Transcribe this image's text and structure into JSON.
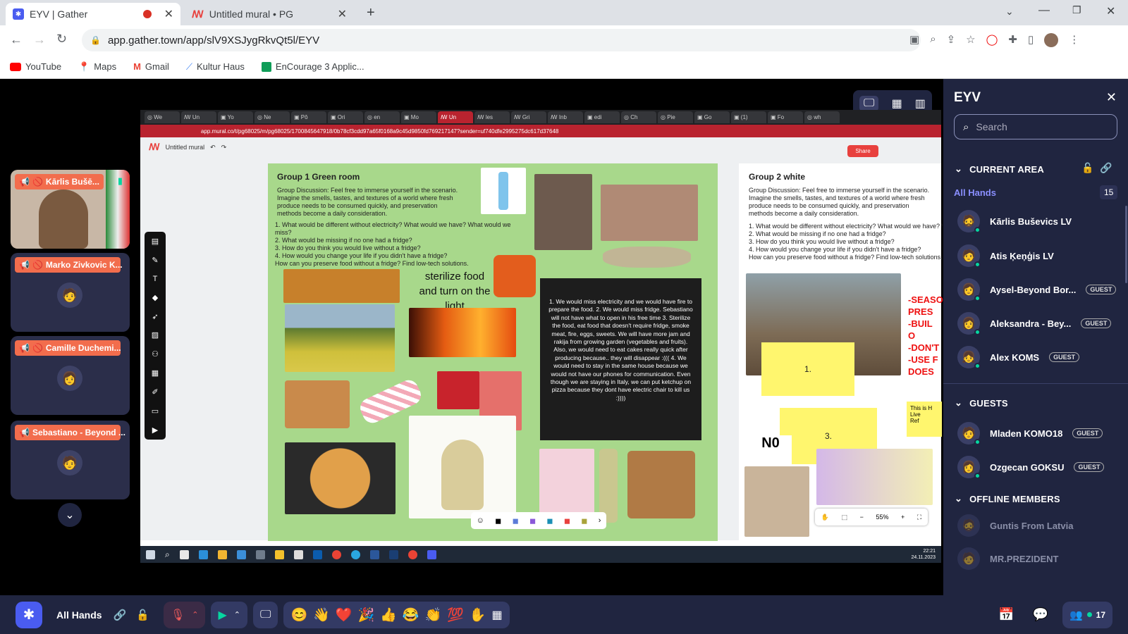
{
  "browser": {
    "tabs": [
      {
        "title": "EYV | Gather",
        "active": true
      },
      {
        "title": "Untitled mural • PG",
        "active": false
      }
    ],
    "url": "app.gather.town/app/slV9XSJygRkvQt5l/EYV",
    "bookmarks": [
      "YouTube",
      "Maps",
      "Gmail",
      "Kultur Haus",
      "EnCourage 3 Applic..."
    ]
  },
  "video_tiles": [
    {
      "name": "Kārlis Bušē..."
    },
    {
      "name": "Marko Zivkovic K..."
    },
    {
      "name": "Camille Duchemi..."
    },
    {
      "name": "Sebastiano - Beyond ..."
    }
  ],
  "shared_screen": {
    "url": "app.mural.co/t/pg68025/m/pg68025/1700845647918/0b78cf3cdd97a65f0168a9c45d9850fd769217147?sender=uf740dfe2995275dc617d37648",
    "mural_title": "Untitled mural",
    "share_label": "Share",
    "zoom": "55%",
    "group1": {
      "title": "Group 1 Green room",
      "intro": "Group Discussion: Feel free to immerse yourself in the scenario. Imagine the smells, tastes, and textures of a world where fresh produce needs to be consumed quickly, and preservation methods become a daily consideration.",
      "questions": [
        "1. What would be different without electricity? What would we have? What would we miss?",
        "2. What would be missing if no one had a fridge?",
        "3. How do you think you would live without a fridge?",
        "4. How would you change your life if you didn't have a fridge?",
        "How can you preserve food without a fridge? Find low-tech solutions."
      ],
      "note": "sterilize food and turn on the light",
      "answer": "1. We would miss electricity and we would have fire to prepare the food. 2. We would miss fridge. Sebastiano will not have what to open in his free time 3. Sterilize the food, eat food that doesn't require fridge, smoke meat, fire, eggs, sweets. We will have more jam and rakija from growing garden (vegetables and fruits). Also, we would need to eat cakes really quick after producing because.. they will disappear :((( 4. We would need to stay in the same house because we would not have our phones for communication. Even though we are staying in Italy, we can put ketchup on pizza because they dont have electric chair to kill us :))))"
    },
    "group2": {
      "title": "Group 2 white",
      "intro": "Group Discussion: Feel free to immerse yourself in the scenario. Imagine the smells, tastes, and textures of a world where fresh produce needs to be consumed quickly, and preservation methods become a daily consideration.",
      "questions": [
        "1. What would be different without electricity? What would we have? What would we miss?",
        "2. What would be missing if no one had a fridge?",
        "3. How do you think you would live without a fridge?",
        "4. How would you change your life if you didn't have a fridge?",
        "How can you preserve food without a fridge? Find low-tech solutions."
      ],
      "stickies": [
        "1.",
        "3."
      ],
      "no_label": "N0",
      "red_notes": "-SEASO\nPRES\n-BUIL\nO\n-DON'T\n-USE F\nDOES",
      "yellow_note": "This is H\nLive\nRef"
    },
    "taskbar_time": "22:21",
    "taskbar_date": "24.11.2023"
  },
  "sidebar": {
    "title": "EYV",
    "search_placeholder": "Search",
    "current_area_label": "CURRENT AREA",
    "area_name": "All Hands",
    "area_count": "15",
    "members": [
      {
        "name": "Kārlis Buševics LV",
        "guest": false
      },
      {
        "name": "Atis Ķeņģis LV",
        "guest": false
      },
      {
        "name": "Aysel-Beyond Bor...",
        "guest": true
      },
      {
        "name": "Aleksandra - Bey...",
        "guest": true
      },
      {
        "name": "Alex KOMS",
        "guest": true
      }
    ],
    "guests_label": "GUESTS",
    "guests": [
      {
        "name": "Mladen KOMO18",
        "guest": true
      },
      {
        "name": "Ozgecan GOKSU",
        "guest": true
      }
    ],
    "offline_label": "OFFLINE MEMBERS",
    "offline": [
      {
        "name": "Guntis From Latvia"
      },
      {
        "name": "MR.PREZIDENT"
      }
    ],
    "guest_badge": "GUEST"
  },
  "bottombar": {
    "area": "All Hands",
    "participants_count": "17",
    "emotes": [
      "😊",
      "👋",
      "❤️",
      "🎉",
      "👍",
      "😂",
      "👏",
      "💯"
    ]
  }
}
